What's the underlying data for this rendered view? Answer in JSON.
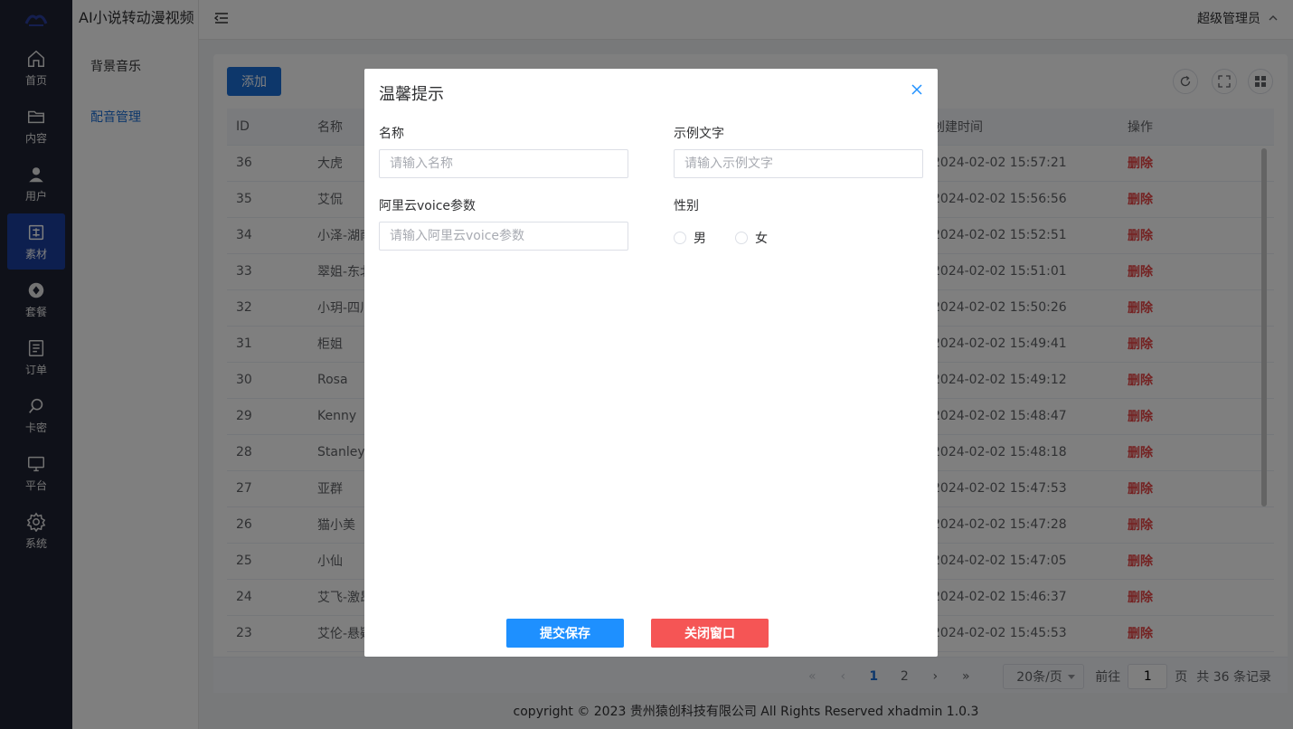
{
  "app": {
    "title": "AI小说转动漫视频",
    "user": "超级管理员"
  },
  "rail": [
    {
      "label": "首页",
      "icon": "home-icon"
    },
    {
      "label": "内容",
      "icon": "folder-icon"
    },
    {
      "label": "用户",
      "icon": "user-icon"
    },
    {
      "label": "素材",
      "icon": "material-icon"
    },
    {
      "label": "套餐",
      "icon": "package-icon"
    },
    {
      "label": "订单",
      "icon": "order-icon"
    },
    {
      "label": "卡密",
      "icon": "key-icon"
    },
    {
      "label": "平台",
      "icon": "monitor-icon"
    },
    {
      "label": "系统",
      "icon": "gear-icon"
    }
  ],
  "submenu": [
    {
      "label": "背景音乐"
    },
    {
      "label": "配音管理"
    }
  ],
  "toolbar": {
    "add_label": "添加"
  },
  "table": {
    "headers": [
      "ID",
      "名称",
      "创建时间",
      "操作"
    ],
    "rows": [
      {
        "id": "36",
        "name": "大虎",
        "time": "2024-02-02 15:57:21",
        "op": "删除"
      },
      {
        "id": "35",
        "name": "艾侃",
        "time": "2024-02-02 15:56:56",
        "op": "删除"
      },
      {
        "id": "34",
        "name": "小泽-湖南",
        "time": "2024-02-02 15:52:51",
        "op": "删除"
      },
      {
        "id": "33",
        "name": "翠姐-东北",
        "time": "2024-02-02 15:51:01",
        "op": "删除"
      },
      {
        "id": "32",
        "name": "小玥-四川",
        "time": "2024-02-02 15:50:26",
        "op": "删除"
      },
      {
        "id": "31",
        "name": "柜姐",
        "time": "2024-02-02 15:49:41",
        "op": "删除"
      },
      {
        "id": "30",
        "name": "Rosa",
        "time": "2024-02-02 15:49:12",
        "op": "删除"
      },
      {
        "id": "29",
        "name": "Kenny",
        "time": "2024-02-02 15:48:47",
        "op": "删除"
      },
      {
        "id": "28",
        "name": "Stanley",
        "time": "2024-02-02 15:48:18",
        "op": "删除"
      },
      {
        "id": "27",
        "name": "亚群",
        "time": "2024-02-02 15:47:53",
        "op": "删除"
      },
      {
        "id": "26",
        "name": "猫小美",
        "time": "2024-02-02 15:47:28",
        "op": "删除"
      },
      {
        "id": "25",
        "name": "小仙",
        "time": "2024-02-02 15:47:05",
        "op": "删除"
      },
      {
        "id": "24",
        "name": "艾飞-激昂",
        "time": "2024-02-02 15:46:37",
        "op": "删除"
      },
      {
        "id": "23",
        "name": "艾伦-悬疑",
        "time": "2024-02-02 15:45:53",
        "op": "删除"
      }
    ]
  },
  "pager": {
    "pages": [
      "1",
      "2"
    ],
    "current": "1",
    "page_size": "20条/页",
    "goto_label": "前往",
    "goto_value": "1",
    "page_unit": "页",
    "total": "共 36 条记录"
  },
  "footer": "copyright © 2023   贵州猿创科技有限公司 All Rights Reserved   xhadmin 1.0.3",
  "dialog": {
    "title": "温馨提示",
    "fields": {
      "name_label": "名称",
      "name_placeholder": "请输入名称",
      "sample_label": "示例文字",
      "sample_placeholder": "请输入示例文字",
      "voice_label": "阿里云voice参数",
      "voice_placeholder": "请输入阿里云voice参数",
      "gender_label": "性别",
      "gender_options": [
        "男",
        "女"
      ]
    },
    "save_label": "提交保存",
    "cancel_label": "关闭窗口"
  },
  "colors": {
    "primary": "#1a6fd6",
    "rail_bg": "#1f2233",
    "danger": "#e84545",
    "save_btn": "#1e90ff",
    "cancel_btn": "#f55555"
  }
}
